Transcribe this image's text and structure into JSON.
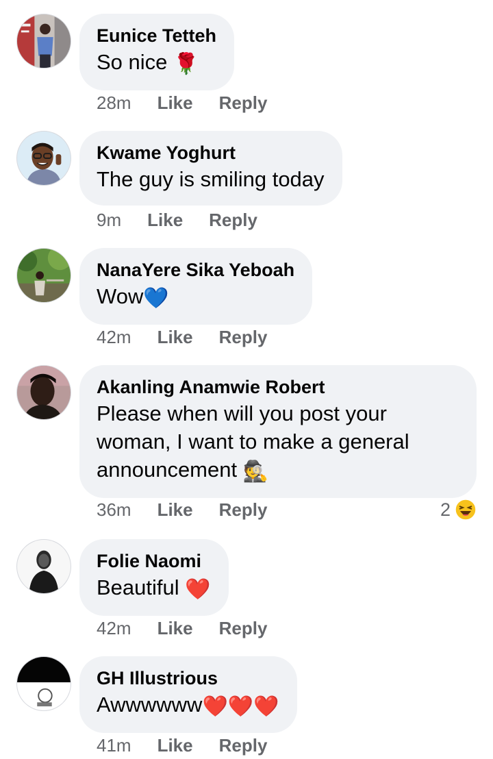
{
  "comments": [
    {
      "name": "Eunice Tetteh",
      "lines": [
        "So nice"
      ],
      "emoji": "🌹",
      "time": "28m",
      "like": "Like",
      "reply": "Reply"
    },
    {
      "name": "Kwame Yoghurt",
      "lines": [
        "The guy is smiling today"
      ],
      "emoji": "",
      "time": "9m",
      "like": "Like",
      "reply": "Reply"
    },
    {
      "name": "NanaYere Sika Yeboah",
      "lines": [
        "Wow"
      ],
      "emoji": "💙",
      "time": "42m",
      "like": "Like",
      "reply": "Reply"
    },
    {
      "name": "Akanling Anamwie Robert",
      "lines": [
        "Please when will you post your",
        "woman, I want to make a general",
        "announcement"
      ],
      "emoji": "🕵️",
      "time": "36m",
      "like": "Like",
      "reply": "Reply",
      "reaction_count": "2",
      "reaction_icon": "laughing-emoji-icon"
    },
    {
      "name": "Folie Naomi",
      "lines": [
        "Beautiful"
      ],
      "emoji": "❤️",
      "time": "42m",
      "like": "Like",
      "reply": "Reply"
    },
    {
      "name": "GH Illustrious",
      "lines": [
        "Awwwwww"
      ],
      "emoji": "❤️❤️❤️",
      "time": "41m",
      "like": "Like",
      "reply": "Reply"
    }
  ],
  "colors": {
    "bubble": "#f0f2f5",
    "name": "#050505",
    "meta": "#65676b",
    "heart": "#e0245e",
    "blue_heart": "#4aa9f2"
  }
}
